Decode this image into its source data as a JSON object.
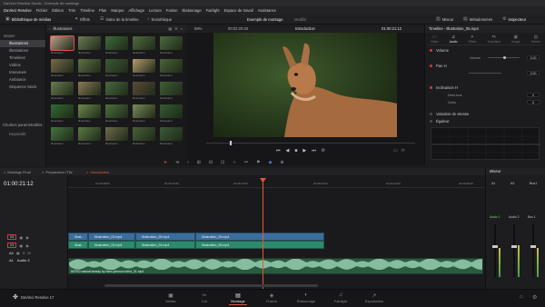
{
  "window": {
    "title": "DaVinci Resolve Studio - Exemple de montage"
  },
  "menu": [
    "DaVinci Resolve",
    "Fichier",
    "Édition",
    "Trim",
    "Timeline",
    "Plan",
    "Marque",
    "Affichage",
    "Lecture",
    "Fusion",
    "Étalonnage",
    "Fairlight",
    "Espace de travail",
    "Assistance"
  ],
  "toolbar": {
    "media_pool": "Bibliothèque de médias",
    "effects": "Effets",
    "edit_index": "Index de la timeline",
    "sound_library": "Sonothèque",
    "project_title": "Exemple de montage",
    "project_status": "Modifié",
    "mixer": "Mixeur",
    "metadata": "Métadonnées",
    "inspector": "Inspecteur"
  },
  "sidebar": {
    "header": "Master",
    "items": [
      {
        "label": "Illustrations",
        "selected": true
      },
      {
        "label": "Illustrations",
        "selected": false
      },
      {
        "label": "Timelines",
        "selected": false
      },
      {
        "label": "Vidéos",
        "selected": false
      },
      {
        "label": "Interviews",
        "selected": false
      },
      {
        "label": "Ambiance",
        "selected": false
      },
      {
        "label": "Séquence Stock",
        "selected": false
      }
    ],
    "smart_bins_header": "Chutiers paramétrables",
    "smart_bins_items": [
      "Keywords"
    ]
  },
  "media_pool": {
    "bin_title": "Illustrations",
    "clip_label": "Illustration",
    "thumbs": [
      {
        "color": "#b7a087"
      },
      {
        "color": "#6b7a55"
      },
      {
        "color": "#3f6a3a"
      },
      {
        "color": "#526b42"
      },
      {
        "color": "#4b6a3d"
      },
      {
        "color": "#7a6a4a"
      },
      {
        "color": "#5f7045"
      },
      {
        "color": "#3d5a35"
      },
      {
        "color": "#b39a6c"
      },
      {
        "color": "#4a6338"
      },
      {
        "color": "#6a7d52"
      },
      {
        "color": "#8b7a55"
      },
      {
        "color": "#486a40"
      },
      {
        "color": "#5d4a3a"
      },
      {
        "color": "#3e5f36"
      },
      {
        "color": "#2f6a34"
      },
      {
        "color": "#6b8a4e"
      },
      {
        "color": "#4c6f3f"
      },
      {
        "color": "#7a8a5a"
      },
      {
        "color": "#355a32"
      },
      {
        "color": "#447540"
      },
      {
        "color": "#5a7a45"
      },
      {
        "color": "#6f6a4a"
      },
      {
        "color": "#4a5f3a"
      },
      {
        "color": "#3a5a36"
      }
    ]
  },
  "viewer": {
    "zoom": "69%",
    "source_tc": "00:02:20:20",
    "clip_name": "Introduction",
    "timecode": "01:00:21:12"
  },
  "inspector": {
    "title": "Timeline - Illustration_05.mp4",
    "tabs": [
      "Vidéo",
      "Audio",
      "Effets",
      "Transition",
      "Image",
      "Fichier"
    ],
    "active_tab": "Audio",
    "sections": {
      "volume": "Volume",
      "volume_label": "Volume",
      "volume_value": "0.00",
      "pan": "Pan H",
      "pan_value": "0.00",
      "pitch": "Inclinaison H",
      "pitch_semitones": "Demi-tons",
      "pitch_semitones_value": "0",
      "pitch_cents": "Cents",
      "pitch_cents_value": "0",
      "speed_variation": "Variation de vitesse",
      "eq": "Égaleur"
    }
  },
  "timeline": {
    "tabs": [
      {
        "label": "Montage Final",
        "active": false
      },
      {
        "label": "Préparation ITW",
        "active": false
      },
      {
        "label": "Introduction",
        "active": true
      }
    ],
    "timecode": "01:00:21:12",
    "ruler": [
      "01:00:08:00",
      "01:00:12:00",
      "01:00:16:00",
      "01:00:20:00",
      "01:00:24:00",
      "01:00:28:00"
    ],
    "tracks": {
      "v2": "V2",
      "v1": "V1",
      "a2": "A2",
      "a1": "A1",
      "a1_name": "Audio 3"
    },
    "clips_v2": [
      "Illust...",
      "Illustration_03.mp4",
      "Illustration_05.mp4",
      "Illustration_05.mp4"
    ],
    "clips_v1": [
      "Illust...",
      "Illustration_03.mp4",
      "Illustration_04.mp4",
      "Illustration_06.mp4"
    ],
    "audio_clip": "INTRO natural beauty by hans johnson mfnd_01.mp4"
  },
  "mixer": {
    "title": "Mixeur",
    "channels": [
      "A1",
      "A2",
      "Bus1"
    ],
    "channel_names": [
      "Audio 1",
      "Audio 2",
      "Bus 1"
    ],
    "fader_levels": [
      0.55,
      0.6,
      0.55
    ]
  },
  "pages": [
    {
      "label": "Media",
      "icon": "media-icon",
      "active": false
    },
    {
      "label": "Cut",
      "icon": "cut-icon",
      "active": false
    },
    {
      "label": "Montage",
      "icon": "edit-icon",
      "active": true
    },
    {
      "label": "Fusion",
      "icon": "fusion-icon",
      "active": false
    },
    {
      "label": "Étalonnage",
      "icon": "color-icon",
      "active": false
    },
    {
      "label": "Fairlight",
      "icon": "fairlight-icon",
      "active": false
    },
    {
      "label": "Exportation",
      "icon": "deliver-icon",
      "active": false
    }
  ],
  "app": {
    "name": "DaVinci Resolve 17"
  }
}
